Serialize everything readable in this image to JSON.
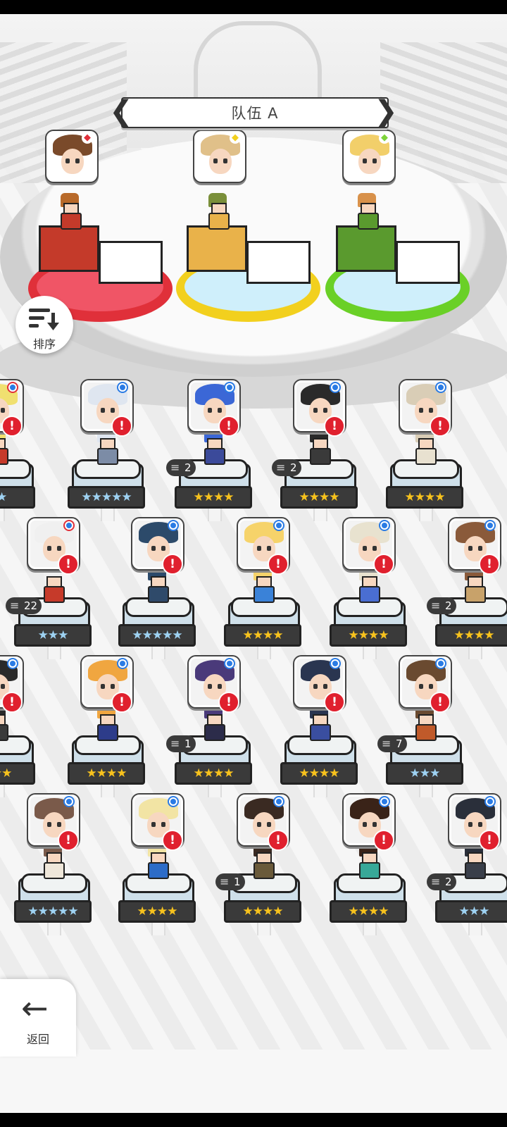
{
  "team": {
    "name": "队伍 A",
    "prev_arrow": "❮",
    "next_arrow": "❯"
  },
  "team_slots": [
    {
      "element": "fire",
      "color": "#e0303a",
      "ring": "#e0303a",
      "block": "#c43a2a",
      "hair": "#7a4a2a",
      "sprite_hair": "#b86a2a"
    },
    {
      "element": "light",
      "color": "#f2d01e",
      "ring": "#f2d01e",
      "block": "#e9b24a",
      "hair": "#e0c089",
      "sprite_hair": "#7a8f3a"
    },
    {
      "element": "earth",
      "color": "#7ed43a",
      "ring": "#6ad027",
      "block": "#5a9a2e",
      "hair": "#f2cf6a",
      "sprite_hair": "#d8914a"
    }
  ],
  "sort_button": {
    "label": "排序"
  },
  "back_button": {
    "label": "返回"
  },
  "roster": [
    {
      "stars": "★★",
      "star_color": "blue",
      "count": "",
      "hair": "#f0e070",
      "body": "#c63a2a",
      "element": "fire"
    },
    {
      "stars": "★★★★★",
      "star_color": "blue",
      "count": "",
      "hair": "#dfe6f0",
      "body": "#7c8ca6",
      "element": "basic"
    },
    {
      "stars": "★★★★",
      "star_color": "gold",
      "count": "2",
      "hair": "#3b67d6",
      "body": "#3b4a9a",
      "element": "basic"
    },
    {
      "stars": "★★★★",
      "star_color": "gold",
      "count": "2",
      "hair": "#2a2a2a",
      "body": "#3a3a3a",
      "element": "basic"
    },
    {
      "stars": "★★★★",
      "star_color": "gold",
      "count": "",
      "hair": "#d9cdb6",
      "body": "#e8e1d0",
      "element": "basic"
    },
    {
      "stars": "★★★",
      "star_color": "blue",
      "count": "22",
      "hair": "#f0f0f0",
      "body": "#c63a2a",
      "element": "fire"
    },
    {
      "stars": "★★★★★",
      "star_color": "blue",
      "count": "",
      "hair": "#2c4a6a",
      "body": "#2f4a6a",
      "element": "basic"
    },
    {
      "stars": "★★★★",
      "star_color": "gold",
      "count": "",
      "hair": "#f6d36a",
      "body": "#3a82d8",
      "element": "basic"
    },
    {
      "stars": "★★★★",
      "star_color": "gold",
      "count": "",
      "hair": "#e8e2cf",
      "body": "#4a6ed2",
      "element": "basic"
    },
    {
      "stars": "★★★★",
      "star_color": "gold",
      "count": "2",
      "hair": "#8a5a3a",
      "body": "#c8a26a",
      "element": "basic"
    },
    {
      "stars": "★★★",
      "star_color": "gold",
      "count": "",
      "hair": "#2a2a2a",
      "body": "#3a3a3a",
      "element": "basic"
    },
    {
      "stars": "★★★★",
      "star_color": "gold",
      "count": "",
      "hair": "#f0a640",
      "body": "#2d3c8a",
      "element": "basic"
    },
    {
      "stars": "★★★★",
      "star_color": "gold",
      "count": "1",
      "hair": "#4a3a7a",
      "body": "#2c2c4a",
      "element": "basic"
    },
    {
      "stars": "★★★★",
      "star_color": "gold",
      "count": "",
      "hair": "#2a3550",
      "body": "#3a4ea0",
      "element": "basic"
    },
    {
      "stars": "★★★",
      "star_color": "blue",
      "count": "7",
      "hair": "#6a4a30",
      "body": "#c05a2a",
      "element": "basic"
    },
    {
      "stars": "★★★★★",
      "star_color": "blue",
      "count": "",
      "hair": "#7a5a4a",
      "body": "#efe7da",
      "element": "basic"
    },
    {
      "stars": "★★★★",
      "star_color": "gold",
      "count": "",
      "hair": "#f2e4a4",
      "body": "#2d6cc8",
      "element": "basic"
    },
    {
      "stars": "★★★★",
      "star_color": "gold",
      "count": "1",
      "hair": "#3a2a22",
      "body": "#6a5a3a",
      "element": "basic"
    },
    {
      "stars": "★★★★",
      "star_color": "gold",
      "count": "",
      "hair": "#3a2318",
      "body": "#38a898",
      "element": "basic"
    },
    {
      "stars": "★★★",
      "star_color": "blue",
      "count": "2",
      "hair": "#2a2f3a",
      "body": "#3a3f4a",
      "element": "basic"
    }
  ],
  "colors": {
    "alert": "#e0202e",
    "basic_badge": "#2a7be4",
    "fire_badge": "#e0303a"
  }
}
